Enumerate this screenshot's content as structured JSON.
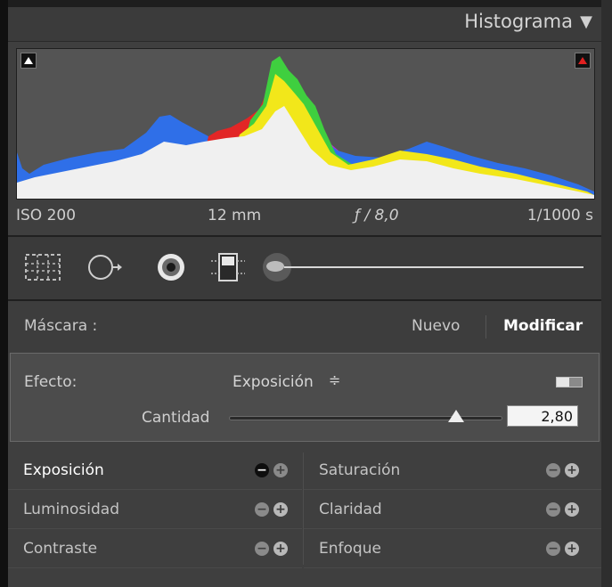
{
  "histogram": {
    "title": "Histograma",
    "collapse_icon": "triangle-down-icon",
    "clip_left_icon": "shadow-clipping-indicator",
    "clip_right_icon": "highlight-clipping-indicator",
    "info": {
      "iso": "ISO 200",
      "focal": "12 mm",
      "aperture": "ƒ / 8,0",
      "shutter": "1/1000 s"
    }
  },
  "tools": [
    {
      "name": "crop-overlay-tool",
      "icon": "crop-icon"
    },
    {
      "name": "spot-removal-tool",
      "icon": "spot-removal-icon"
    },
    {
      "name": "red-eye-tool",
      "icon": "red-eye-icon"
    },
    {
      "name": "graduated-filter-tool",
      "icon": "graduated-filter-icon"
    },
    {
      "name": "adjustment-brush-tool",
      "icon": "adjustment-brush-icon"
    }
  ],
  "mask": {
    "label": "Máscara :",
    "new": "Nuevo",
    "edit": "Modificar"
  },
  "effect": {
    "label": "Efecto:",
    "value": "Exposición",
    "arrows": "≑",
    "amount_label": "Cantidad",
    "amount_value": "2,80",
    "amount_fraction": 0.83
  },
  "presets": {
    "left": [
      {
        "label": "Exposición",
        "active": true
      },
      {
        "label": "Luminosidad",
        "active": false
      },
      {
        "label": "Contraste",
        "active": false
      }
    ],
    "right": [
      {
        "label": "Saturación",
        "active": false
      },
      {
        "label": "Claridad",
        "active": false
      },
      {
        "label": "Enfoque",
        "active": false
      }
    ],
    "minus_symbol": "−",
    "plus_symbol": "+"
  },
  "colors": {
    "panel_bg": "#3f3f3f",
    "effect_bg": "#4c4c4c",
    "hist_blue": "#2f6fe8",
    "hist_yellow": "#f2e71a",
    "hist_green": "#3fcf3f",
    "hist_red": "#e22626",
    "hist_magenta": "#c026d3",
    "hist_white": "#f0f0f0"
  }
}
